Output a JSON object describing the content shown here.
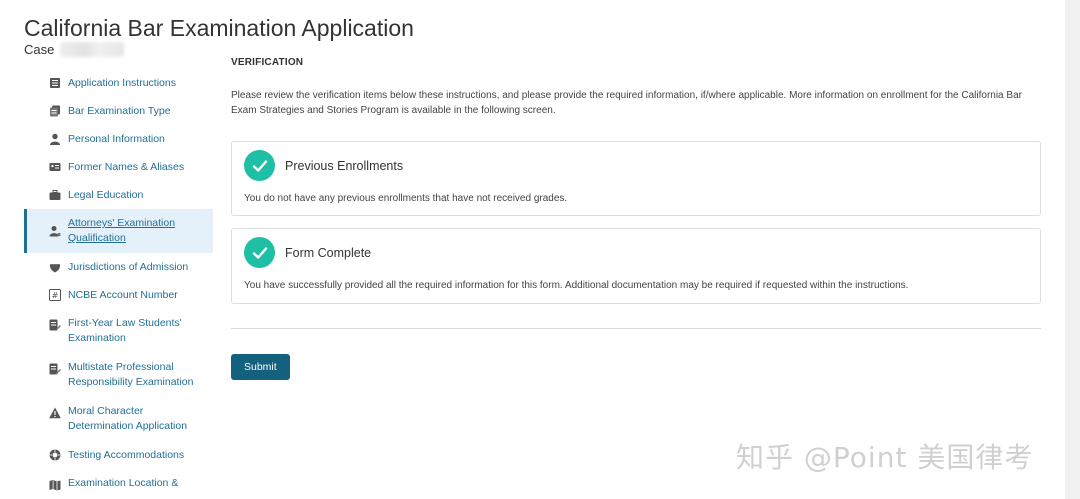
{
  "header": {
    "title": "California Bar Examination Application",
    "case_label": "Case"
  },
  "sidebar": {
    "items": [
      {
        "label": "Application Instructions",
        "icon": "list-icon"
      },
      {
        "label": "Bar Examination Type",
        "icon": "documents-icon"
      },
      {
        "label": "Personal Information",
        "icon": "person-icon"
      },
      {
        "label": "Former Names & Aliases",
        "icon": "id-card-icon"
      },
      {
        "label": "Legal Education",
        "icon": "briefcase-icon"
      },
      {
        "label": "Attorneys' Examination Qualification",
        "icon": "attorney-icon",
        "active": true
      },
      {
        "label": "Jurisdictions of Admission",
        "icon": "badge-icon"
      },
      {
        "label": "NCBE Account Number",
        "icon": "hash-icon"
      },
      {
        "label": "First-Year Law Students' Examination",
        "icon": "edit-document-icon"
      },
      {
        "label": "Multistate Professional Responsibility Examination",
        "icon": "edit-document-icon"
      },
      {
        "label": "Moral Character Determination Application",
        "icon": "warning-icon"
      },
      {
        "label": "Testing Accommodations",
        "icon": "lifebuoy-icon"
      },
      {
        "label": "Examination Location &",
        "icon": "map-icon"
      }
    ]
  },
  "main": {
    "section_title": "VERIFICATION",
    "intro": "Please review the verification items below these instructions, and please provide the required information, if/where applicable. More information on enrollment for the California Bar Exam Strategies and Stories Program is available in the following screen.",
    "cards": [
      {
        "title": "Previous Enrollments",
        "text": "You do not have any previous enrollments that have not received grades."
      },
      {
        "title": "Form Complete",
        "text": "You have successfully provided all the required information for this form. Additional documentation may be required if requested within the instructions."
      }
    ],
    "submit_label": "Submit"
  },
  "watermark": "知乎 @Point 美国律考",
  "colors": {
    "accent": "#1f6f95",
    "check": "#1fbfa5",
    "submit": "#14607f",
    "active_bg": "#e4f1fa"
  }
}
